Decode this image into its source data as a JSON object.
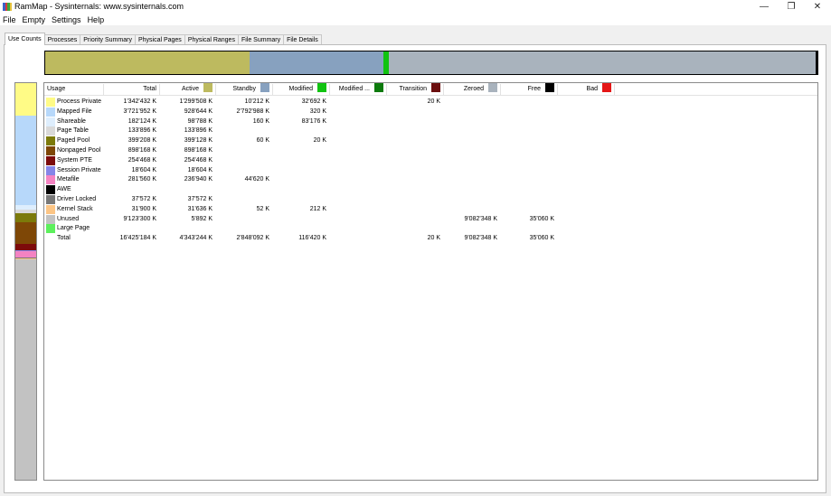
{
  "window": {
    "title": "RamMap - Sysinternals: www.sysinternals.com",
    "controls": {
      "minimize": "—",
      "restore": "❐",
      "close": "✕"
    }
  },
  "menu": [
    "File",
    "Empty",
    "Settings",
    "Help"
  ],
  "tabs": [
    "Use Counts",
    "Processes",
    "Priority Summary",
    "Physical Pages",
    "Physical Ranges",
    "File Summary",
    "File Details"
  ],
  "columns": [
    {
      "label": "Usage",
      "color": null
    },
    {
      "label": "Total",
      "color": null
    },
    {
      "label": "Active",
      "color": "#bdba5f"
    },
    {
      "label": "Standby",
      "color": "#87a1bf"
    },
    {
      "label": "Modified",
      "color": "#11c311"
    },
    {
      "label": "Modified ...",
      "color": "#0d7a0d"
    },
    {
      "label": "Transition",
      "color": "#6a0e0e"
    },
    {
      "label": "Zeroed",
      "color": "#a9b3bd"
    },
    {
      "label": "Free",
      "color": "#000000"
    },
    {
      "label": "Bad",
      "color": "#e41616"
    }
  ],
  "rows": [
    {
      "usage": "Process Private",
      "color": "#fffb86",
      "values": [
        "1'342'432 K",
        "1'299'508 K",
        "10'212 K",
        "32'692 K",
        "",
        "20 K",
        "",
        "",
        ""
      ]
    },
    {
      "usage": "Mapped File",
      "color": "#b7d8fa",
      "values": [
        "3'721'952 K",
        "928'644 K",
        "2'792'988 K",
        "320 K",
        "",
        "",
        "",
        "",
        ""
      ]
    },
    {
      "usage": "Shareable",
      "color": "#deeefd",
      "values": [
        "182'124 K",
        "98'788 K",
        "160 K",
        "83'176 K",
        "",
        "",
        "",
        "",
        ""
      ]
    },
    {
      "usage": "Page Table",
      "color": "#d9d9d9",
      "values": [
        "133'896 K",
        "133'896 K",
        "",
        "",
        "",
        "",
        "",
        "",
        ""
      ]
    },
    {
      "usage": "Paged Pool",
      "color": "#7c7a0a",
      "values": [
        "399'208 K",
        "399'128 K",
        "60 K",
        "20 K",
        "",
        "",
        "",
        "",
        ""
      ]
    },
    {
      "usage": "Nonpaged Pool",
      "color": "#7e4706",
      "values": [
        "898'168 K",
        "898'168 K",
        "",
        "",
        "",
        "",
        "",
        "",
        ""
      ]
    },
    {
      "usage": "System PTE",
      "color": "#7d0b0b",
      "values": [
        "254'468 K",
        "254'468 K",
        "",
        "",
        "",
        "",
        "",
        "",
        ""
      ]
    },
    {
      "usage": "Session Private",
      "color": "#8585e8",
      "values": [
        "18'604 K",
        "18'604 K",
        "",
        "",
        "",
        "",
        "",
        "",
        ""
      ]
    },
    {
      "usage": "Metafile",
      "color": "#f483c2",
      "values": [
        "281'560 K",
        "236'940 K",
        "44'620 K",
        "",
        "",
        "",
        "",
        "",
        ""
      ]
    },
    {
      "usage": "AWE",
      "color": "#000000",
      "values": [
        "",
        "",
        "",
        "",
        "",
        "",
        "",
        "",
        ""
      ]
    },
    {
      "usage": "Driver Locked",
      "color": "#787878",
      "values": [
        "37'572 K",
        "37'572 K",
        "",
        "",
        "",
        "",
        "",
        "",
        ""
      ]
    },
    {
      "usage": "Kernel Stack",
      "color": "#fcc585",
      "values": [
        "31'900 K",
        "31'636 K",
        "52 K",
        "212 K",
        "",
        "",
        "",
        "",
        ""
      ]
    },
    {
      "usage": "Unused",
      "color": "#c2c2c2",
      "values": [
        "9'123'300 K",
        "5'892 K",
        "",
        "",
        "",
        "",
        "9'082'348 K",
        "35'060 K",
        ""
      ]
    },
    {
      "usage": "Large Page",
      "color": "#5cf05c",
      "values": [
        "",
        "",
        "",
        "",
        "",
        "",
        "",
        "",
        ""
      ]
    },
    {
      "usage": "Total",
      "color": null,
      "values": [
        "16'425'184 K",
        "4'343'244 K",
        "2'848'092 K",
        "116'420 K",
        "",
        "20 K",
        "9'082'348 K",
        "35'060 K",
        ""
      ]
    }
  ],
  "top_bar": [
    {
      "state": "Active",
      "value_k": 4343244,
      "color": "#bdba5f"
    },
    {
      "state": "Standby",
      "value_k": 2848092,
      "color": "#87a1bf"
    },
    {
      "state": "Modified",
      "value_k": 116420,
      "color": "#11c311"
    },
    {
      "state": "Zeroed",
      "value_k": 9082348,
      "color": "#a9b3bd"
    },
    {
      "state": "Free",
      "value_k": 35060,
      "color": "#000000"
    }
  ],
  "side_bar": [
    {
      "usage": "Process Private",
      "value_k": 1342432,
      "color": "#fffb86"
    },
    {
      "usage": "Mapped File",
      "value_k": 3721952,
      "color": "#b7d8fa"
    },
    {
      "usage": "Shareable",
      "value_k": 182124,
      "color": "#deeefd"
    },
    {
      "usage": "Page Table",
      "value_k": 133896,
      "color": "#d9d9d9"
    },
    {
      "usage": "Paged Pool",
      "value_k": 399208,
      "color": "#7c7a0a"
    },
    {
      "usage": "Nonpaged Pool",
      "value_k": 898168,
      "color": "#7e4706"
    },
    {
      "usage": "System PTE",
      "value_k": 254468,
      "color": "#7d0b0b"
    },
    {
      "usage": "Session Private",
      "value_k": 18604,
      "color": "#8585e8"
    },
    {
      "usage": "Metafile",
      "value_k": 281560,
      "color": "#f483c2"
    },
    {
      "usage": "Driver Locked",
      "value_k": 37572,
      "color": "#787878"
    },
    {
      "usage": "Kernel Stack",
      "value_k": 31900,
      "color": "#fcc585"
    },
    {
      "usage": "Unused",
      "value_k": 9123300,
      "color": "#c2c2c2"
    }
  ]
}
